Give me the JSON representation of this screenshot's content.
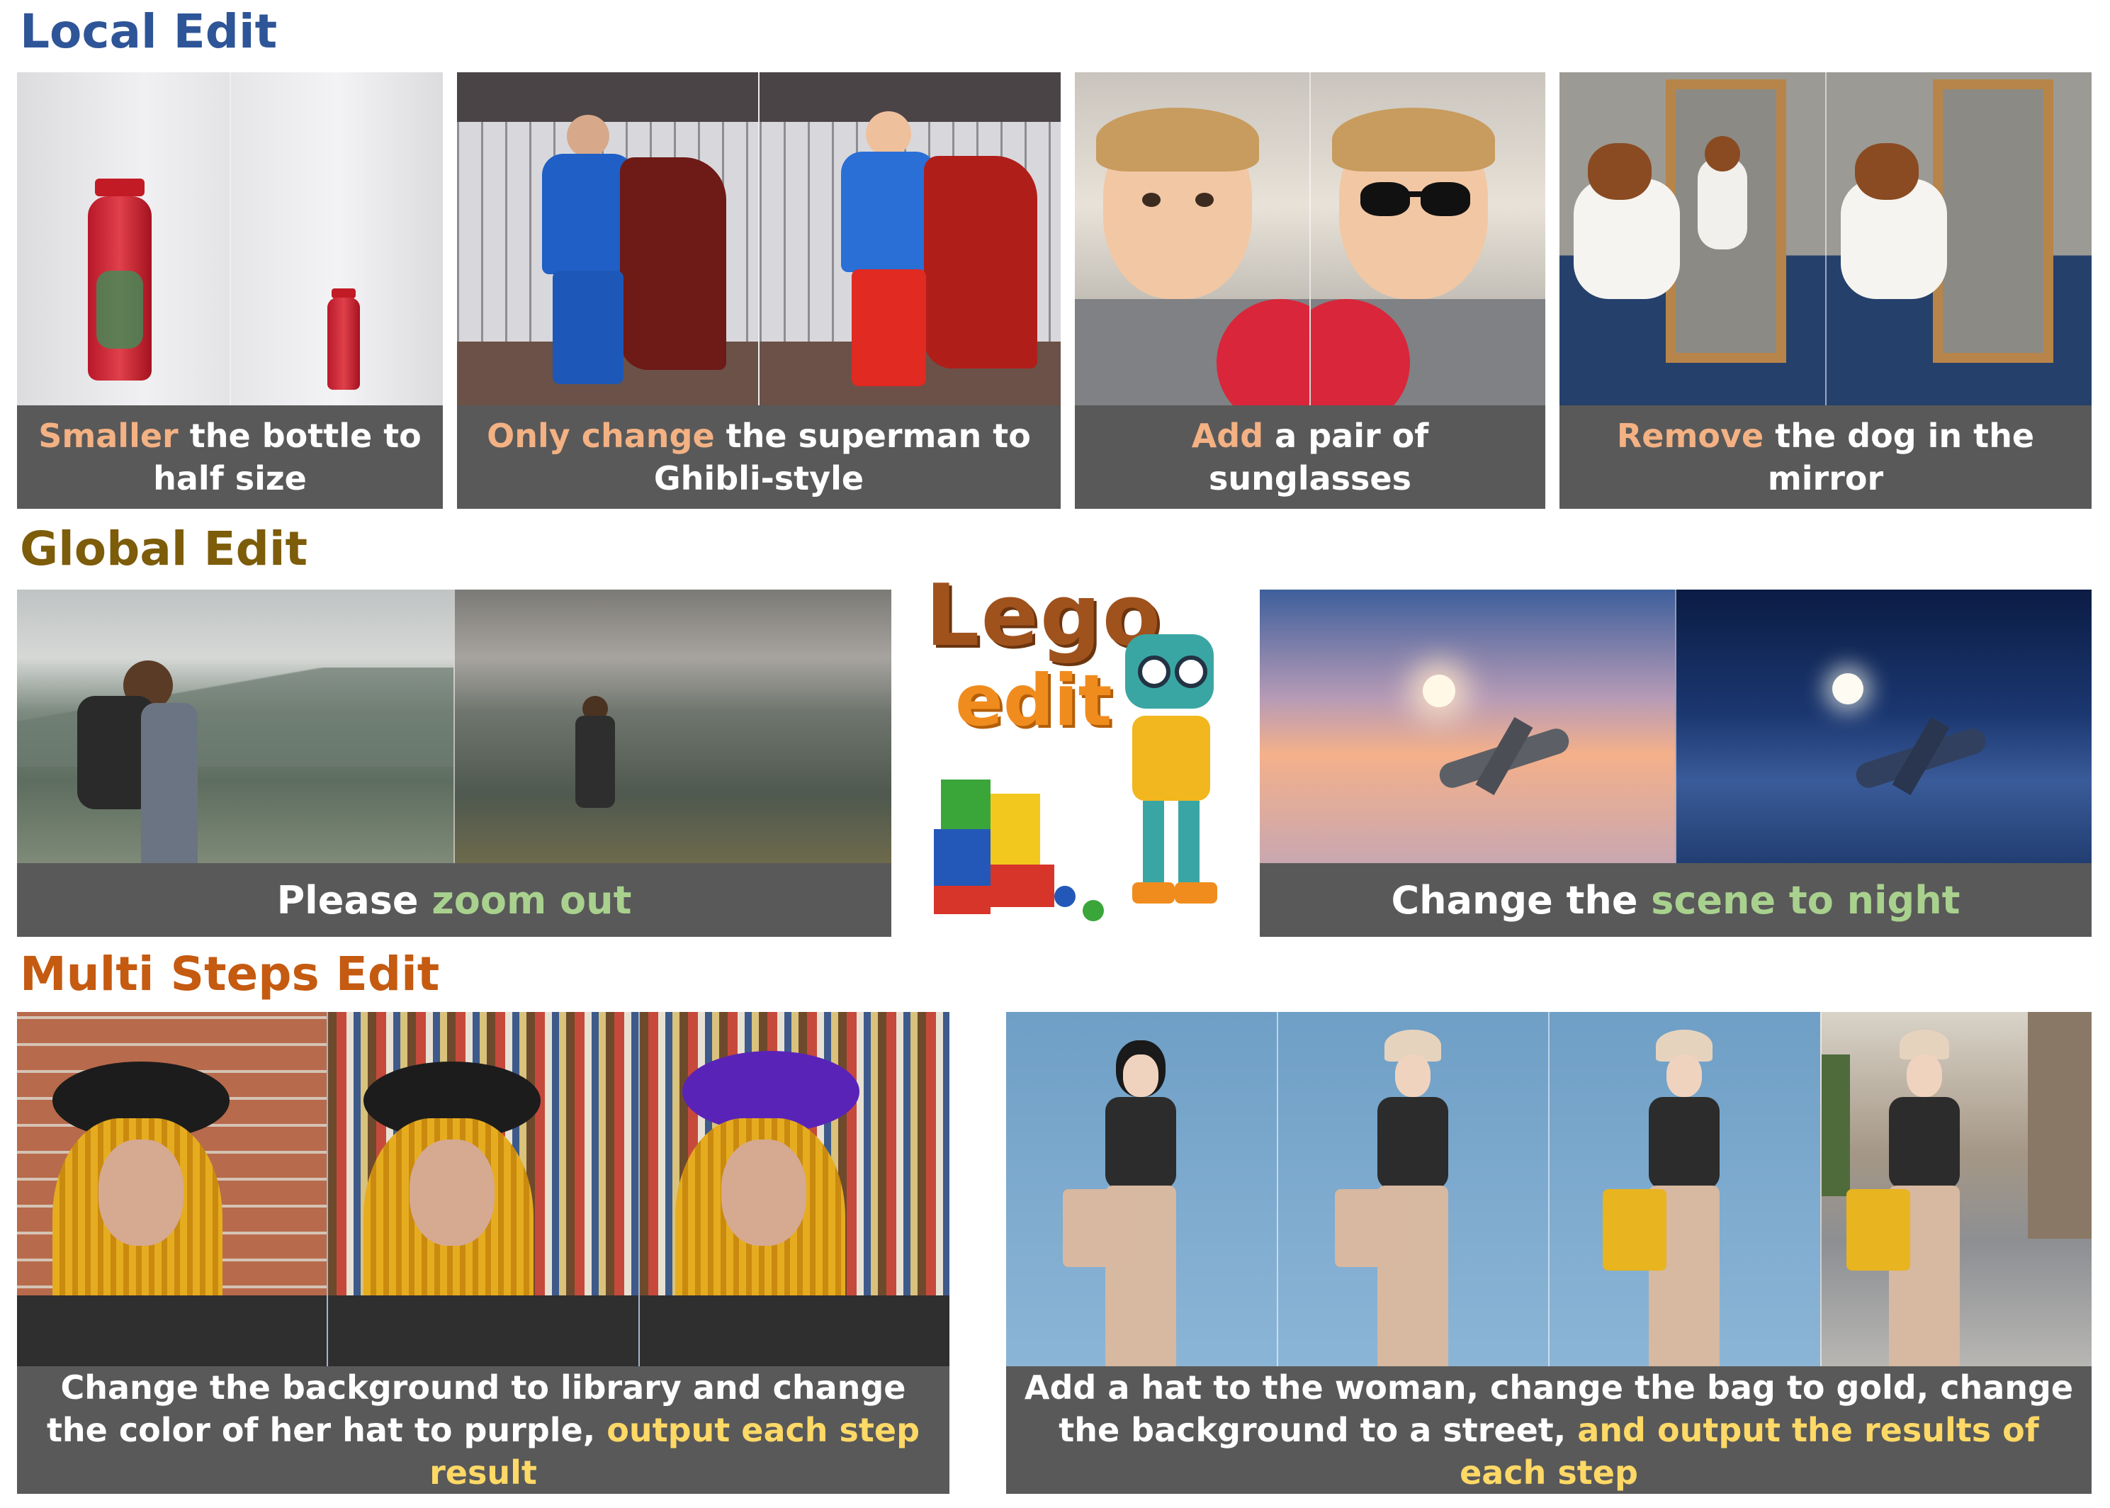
{
  "sections": {
    "local": {
      "title": "Local Edit",
      "color": "#2e5597"
    },
    "global": {
      "title": "Global Edit",
      "color": "#7d5c0a"
    },
    "multi": {
      "title": "Multi Steps Edit",
      "color": "#c55a11"
    }
  },
  "colors": {
    "caption_bg": "#595959",
    "local_highlight": "#f4b183",
    "global_highlight": "#a9d18e",
    "multi_highlight": "#ffd966"
  },
  "logo": {
    "word1": "Lego",
    "word2": "edit"
  },
  "local_panels": [
    {
      "id": "bottle",
      "highlight": "Smaller",
      "rest": " the bottle to half size"
    },
    {
      "id": "superman",
      "highlight": "Only change",
      "rest": " the superman to Ghibli-style"
    },
    {
      "id": "sunglasses",
      "highlight": "Add",
      "rest": " a pair of sunglasses"
    },
    {
      "id": "dog",
      "highlight": "Remove",
      "rest": " the dog in the mirror"
    }
  ],
  "global_panels": [
    {
      "id": "zoom",
      "prefix": "Please ",
      "highlight": "zoom out"
    },
    {
      "id": "night",
      "prefix": "Change the ",
      "highlight": "scene to night"
    }
  ],
  "multi_panels": [
    {
      "id": "library",
      "prefix": "Change the background to library and change the color of her hat to purple, ",
      "highlight": "output each step result"
    },
    {
      "id": "street",
      "prefix": "Add a hat to the woman, change the bag to gold, change the background to a street, ",
      "highlight": "and output the results of each step"
    }
  ]
}
